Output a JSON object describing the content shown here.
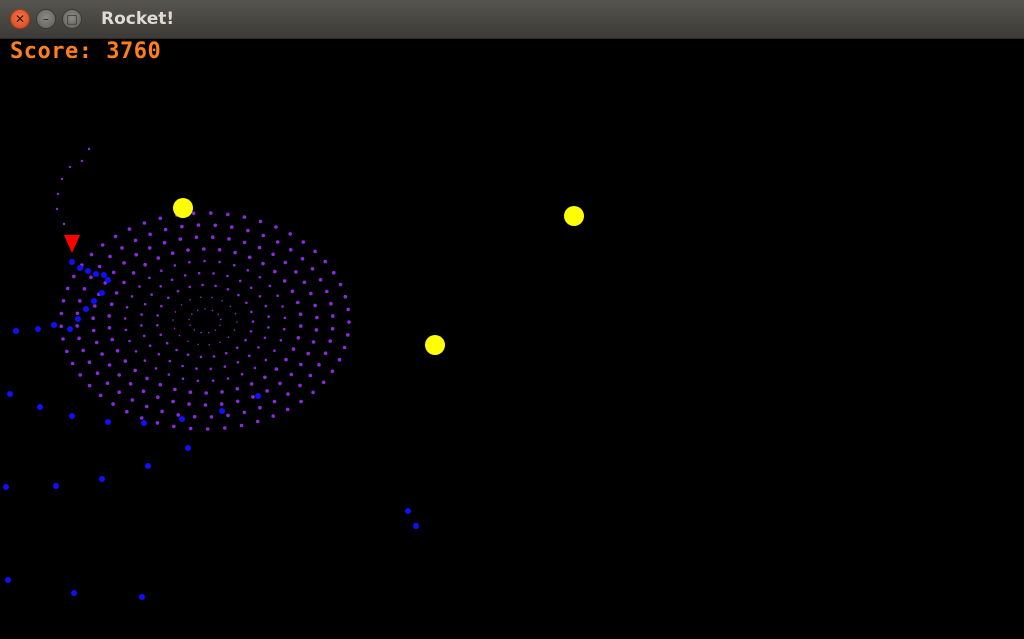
{
  "window": {
    "title": "Rocket!",
    "controls": {
      "close_icon": "close-icon",
      "minimize_icon": "minimize-icon",
      "maximize_icon": "maximize-icon"
    }
  },
  "hud": {
    "score_text": "Score: 3760",
    "score_color": "#ff7f1a"
  },
  "colors": {
    "background": "#000000",
    "planet": "#ffff00",
    "rocket": "#ff0000",
    "particle_blue": "#1010ff",
    "particle_purple": "#8a2be2"
  },
  "icons": [
    "close-icon",
    "minimize-icon",
    "maximize-icon",
    "rocket-icon",
    "planet-icon"
  ]
}
